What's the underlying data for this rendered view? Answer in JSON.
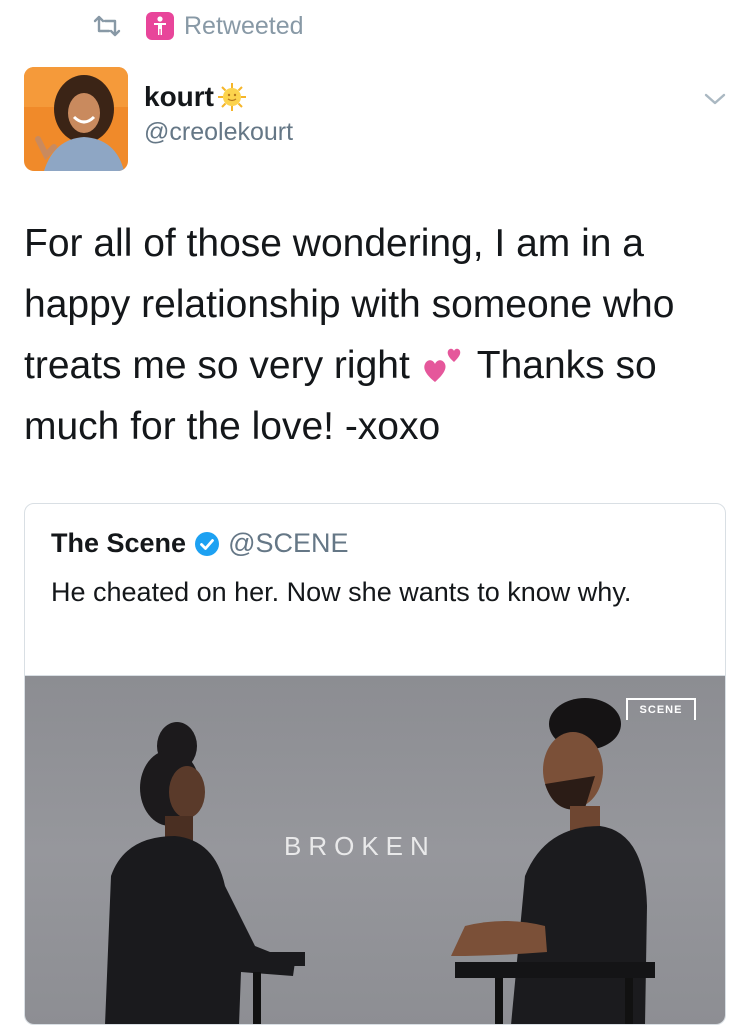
{
  "retweet": {
    "label": "Retweeted"
  },
  "author": {
    "name": "kourt",
    "handle": "@creolekourt"
  },
  "tweet": {
    "text_before_emoji": "For all of those wondering, I am in a happy relationship with someone who treats me so very right ",
    "text_after_emoji": " Thanks so much for the love! -xoxo"
  },
  "quoted_tweet": {
    "name": "The Scene",
    "handle": "@SCENE",
    "text": "He cheated on her. Now she wants to know why.",
    "media": {
      "logo_text": "SCENE",
      "title_text": "BROKEN"
    }
  },
  "icons": {
    "retweet": "retweet-icon",
    "badge": "person-badge-icon",
    "sun": "sun-emoji-icon",
    "caret": "chevron-down-icon",
    "heart": "two-hearts-emoji-icon",
    "verified": "verified-badge-icon"
  },
  "colors": {
    "text": "#14171a",
    "muted": "#657786",
    "retweet_label": "#8899a6",
    "verified": "#1da1f2",
    "badge": "#e8459a",
    "border": "#d9dfe4"
  }
}
